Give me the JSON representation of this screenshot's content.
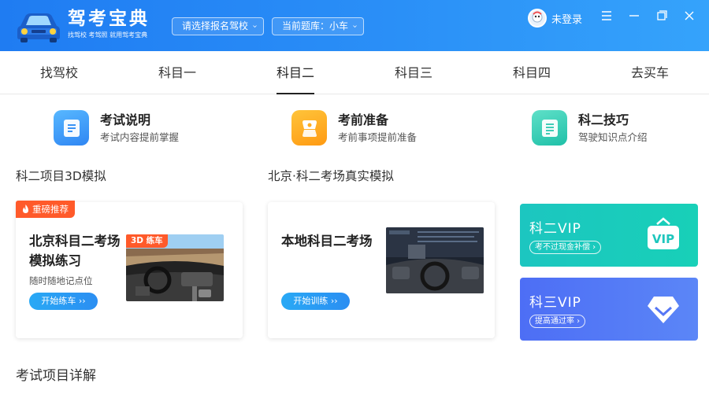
{
  "app": {
    "name": "驾考宝典",
    "slogan": "找驾校 考驾照 就用驾考宝典"
  },
  "header": {
    "school_select": "请选择报名驾校",
    "bank_select": "当前题库：小车",
    "login": "未登录"
  },
  "tabs": [
    {
      "label": "找驾校"
    },
    {
      "label": "科目一"
    },
    {
      "label": "科目二"
    },
    {
      "label": "科目三"
    },
    {
      "label": "科目四"
    },
    {
      "label": "去买车"
    }
  ],
  "active_tab": "科目二",
  "quick_links": [
    {
      "title": "考试说明",
      "subtitle": "考试内容提前掌握",
      "icon": "document-icon"
    },
    {
      "title": "考前准备",
      "subtitle": "考前事项提前准备",
      "icon": "car-seat-icon"
    },
    {
      "title": "科二技巧",
      "subtitle": "驾驶知识点介绍",
      "icon": "tips-icon"
    }
  ],
  "section_3d": {
    "title": "科二项目3D模拟",
    "badge": "重磅推荐",
    "card_title_line1": "北京科目二考场",
    "card_title_line2": "模拟练习",
    "card_subtitle": "随时随地记点位",
    "tag": "3D 练车",
    "button": "开始练车 ››"
  },
  "section_real": {
    "title": "北京·科二考场真实模拟",
    "card_title": "本地科目二考场",
    "button": "开始训练 ››"
  },
  "vip_cards": [
    {
      "title": "科二VIP",
      "subtitle": "考不过现金补偿 ›",
      "icon": "vip-badge-icon"
    },
    {
      "title": "科三VIP",
      "subtitle": "提高通过率 ›",
      "icon": "diamond-icon"
    }
  ],
  "exam_details_title": "考试项目详解",
  "colors": {
    "header_blue": "#2a8ff7",
    "badge_orange": "#ff5a2a",
    "vip_teal": "#1cc6c0",
    "vip_blue": "#4d6ef5"
  }
}
